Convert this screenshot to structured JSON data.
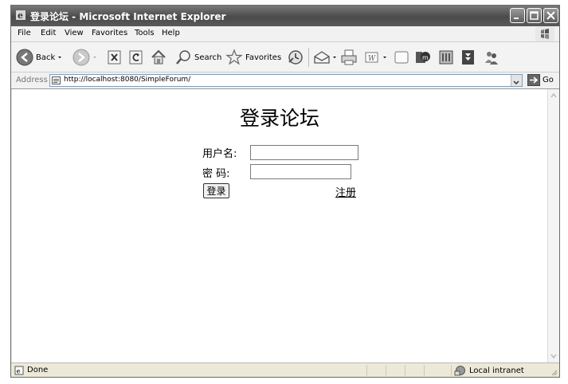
{
  "window": {
    "title": "登录论坛 - Microsoft Internet Explorer"
  },
  "menu": [
    "File",
    "Edit",
    "View",
    "Favorites",
    "Tools",
    "Help"
  ],
  "toolbar": {
    "back_label": "Back",
    "search_label": "Search",
    "favorites_label": "Favorites"
  },
  "address": {
    "label": "Address",
    "url": "http://localhost:8080/SimpleForum/",
    "go_label": "Go"
  },
  "page": {
    "heading": "登录论坛",
    "username_label": "用户名:",
    "username_value": "",
    "password_label": "密 码:",
    "password_value": "",
    "login_button": "登录",
    "register_link": "注册"
  },
  "status": {
    "text": "Done",
    "zone": "Local intranet"
  }
}
